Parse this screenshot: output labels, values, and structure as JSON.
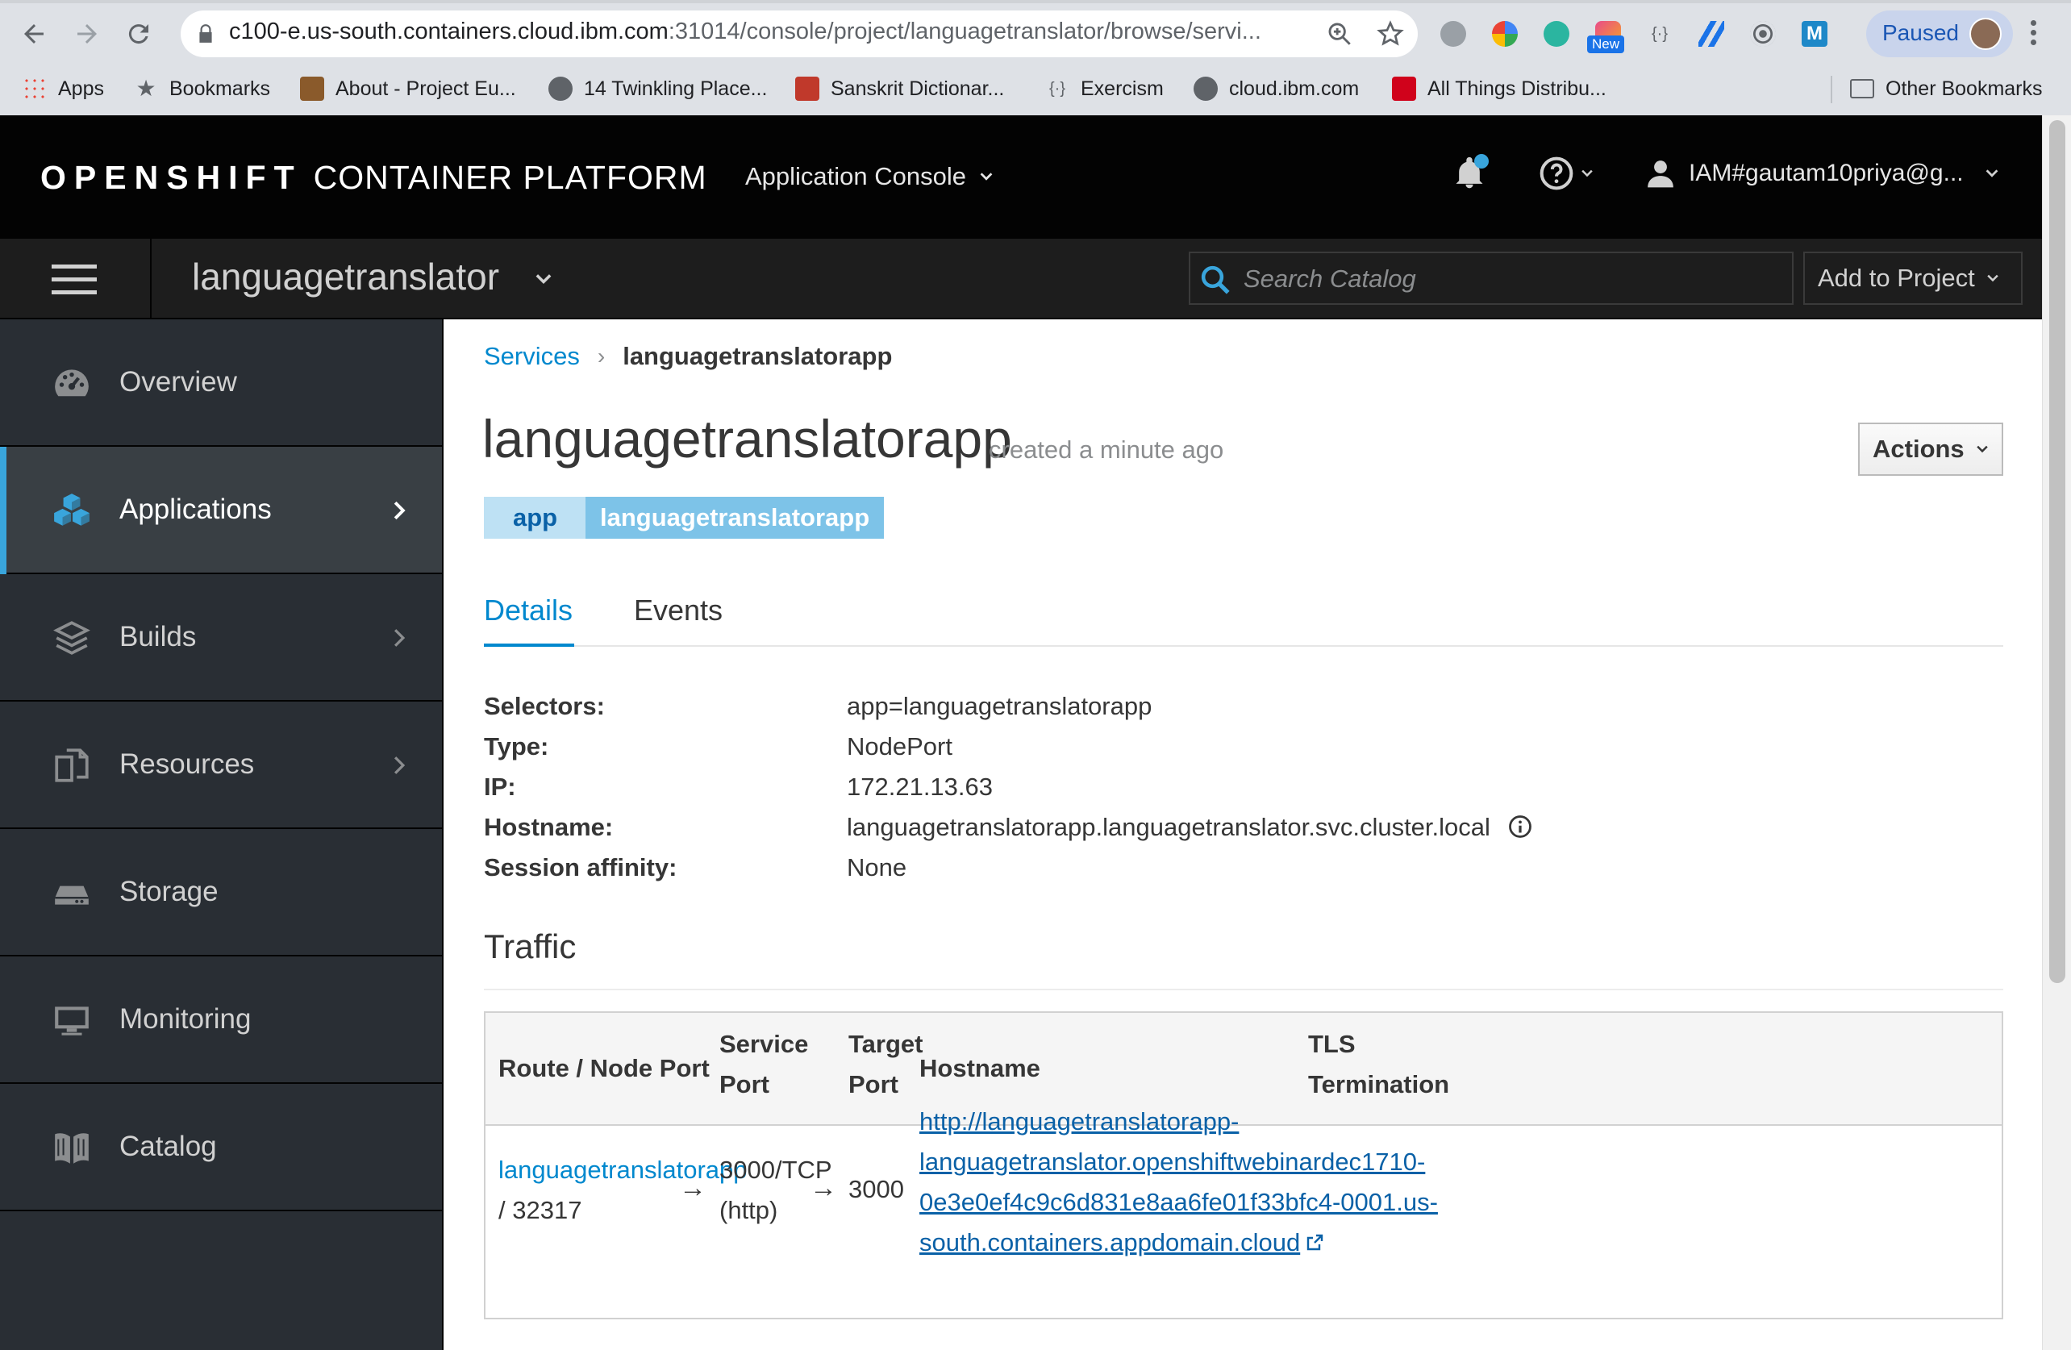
{
  "browser": {
    "url_main": "c100-e.us-south.containers.cloud.ibm.com",
    "url_rest": ":31014/console/project/languagetranslator/browse/servi...",
    "paused_label": "Paused",
    "extension_badge": "New"
  },
  "bookmarks": [
    {
      "label": "Apps"
    },
    {
      "label": "Bookmarks"
    },
    {
      "label": "About - Project Eu..."
    },
    {
      "label": "14 Twinkling Place..."
    },
    {
      "label": "Sanskrit Dictionar..."
    },
    {
      "label": "Exercism"
    },
    {
      "label": "cloud.ibm.com"
    },
    {
      "label": "All Things Distribu..."
    },
    {
      "label": "Other Bookmarks"
    }
  ],
  "header": {
    "brand_bold": "OPENSHIFT",
    "brand_rest": "CONTAINER PLATFORM",
    "app_console": "Application Console",
    "user": "IAM#gautam10priya@g..."
  },
  "project_bar": {
    "project": "languagetranslator",
    "search_placeholder": "Search Catalog",
    "add_to_project": "Add to Project"
  },
  "sidebar": {
    "items": [
      {
        "label": "Overview",
        "icon": "dashboard-icon"
      },
      {
        "label": "Applications",
        "icon": "cubes-icon"
      },
      {
        "label": "Builds",
        "icon": "layers-icon"
      },
      {
        "label": "Resources",
        "icon": "files-icon"
      },
      {
        "label": "Storage",
        "icon": "storage-icon"
      },
      {
        "label": "Monitoring",
        "icon": "monitor-icon"
      },
      {
        "label": "Catalog",
        "icon": "book-icon"
      }
    ]
  },
  "breadcrumb": {
    "parent": "Services",
    "current": "languagetranslatorapp"
  },
  "page": {
    "title": "languagetranslatorapp",
    "created": "created a minute ago",
    "actions": "Actions",
    "label_key": "app",
    "label_value": "languagetranslatorapp"
  },
  "tabs": [
    {
      "label": "Details"
    },
    {
      "label": "Events"
    }
  ],
  "details": [
    {
      "label": "Selectors:",
      "value": "app=languagetranslatorapp"
    },
    {
      "label": "Type:",
      "value": "NodePort"
    },
    {
      "label": "IP:",
      "value": "172.21.13.63"
    },
    {
      "label": "Hostname:",
      "value": "languagetranslatorapp.languagetranslator.svc.cluster.local"
    },
    {
      "label": "Session affinity:",
      "value": "None"
    }
  ],
  "traffic": {
    "title": "Traffic",
    "headers": {
      "route": "Route / Node Port",
      "service_1": "Service",
      "service_2": "Port",
      "target_1": "Target",
      "target_2": "Port",
      "hostname": "Hostname",
      "tls_1": "TLS",
      "tls_2": "Termination"
    },
    "row": {
      "route": "languagetranslatorapp",
      "node_port": "/ 32317",
      "service_port_1": "3000/TCP",
      "service_port_2": "(http)",
      "target_port": "3000",
      "hostname_lines": [
        "http://languagetranslatorapp-",
        "languagetranslator.openshiftwebinardec1710-",
        "0e3e0ef4c9c6d831e8aa6fe01f33bfc4-0001.us-",
        "south.containers.appdomain.cloud"
      ],
      "arrow": "→"
    }
  },
  "colors": {
    "header_bg": "#030303",
    "sidebar_bg": "#292e34",
    "accent": "#0088ce",
    "active_bar": "#39a5dc"
  }
}
